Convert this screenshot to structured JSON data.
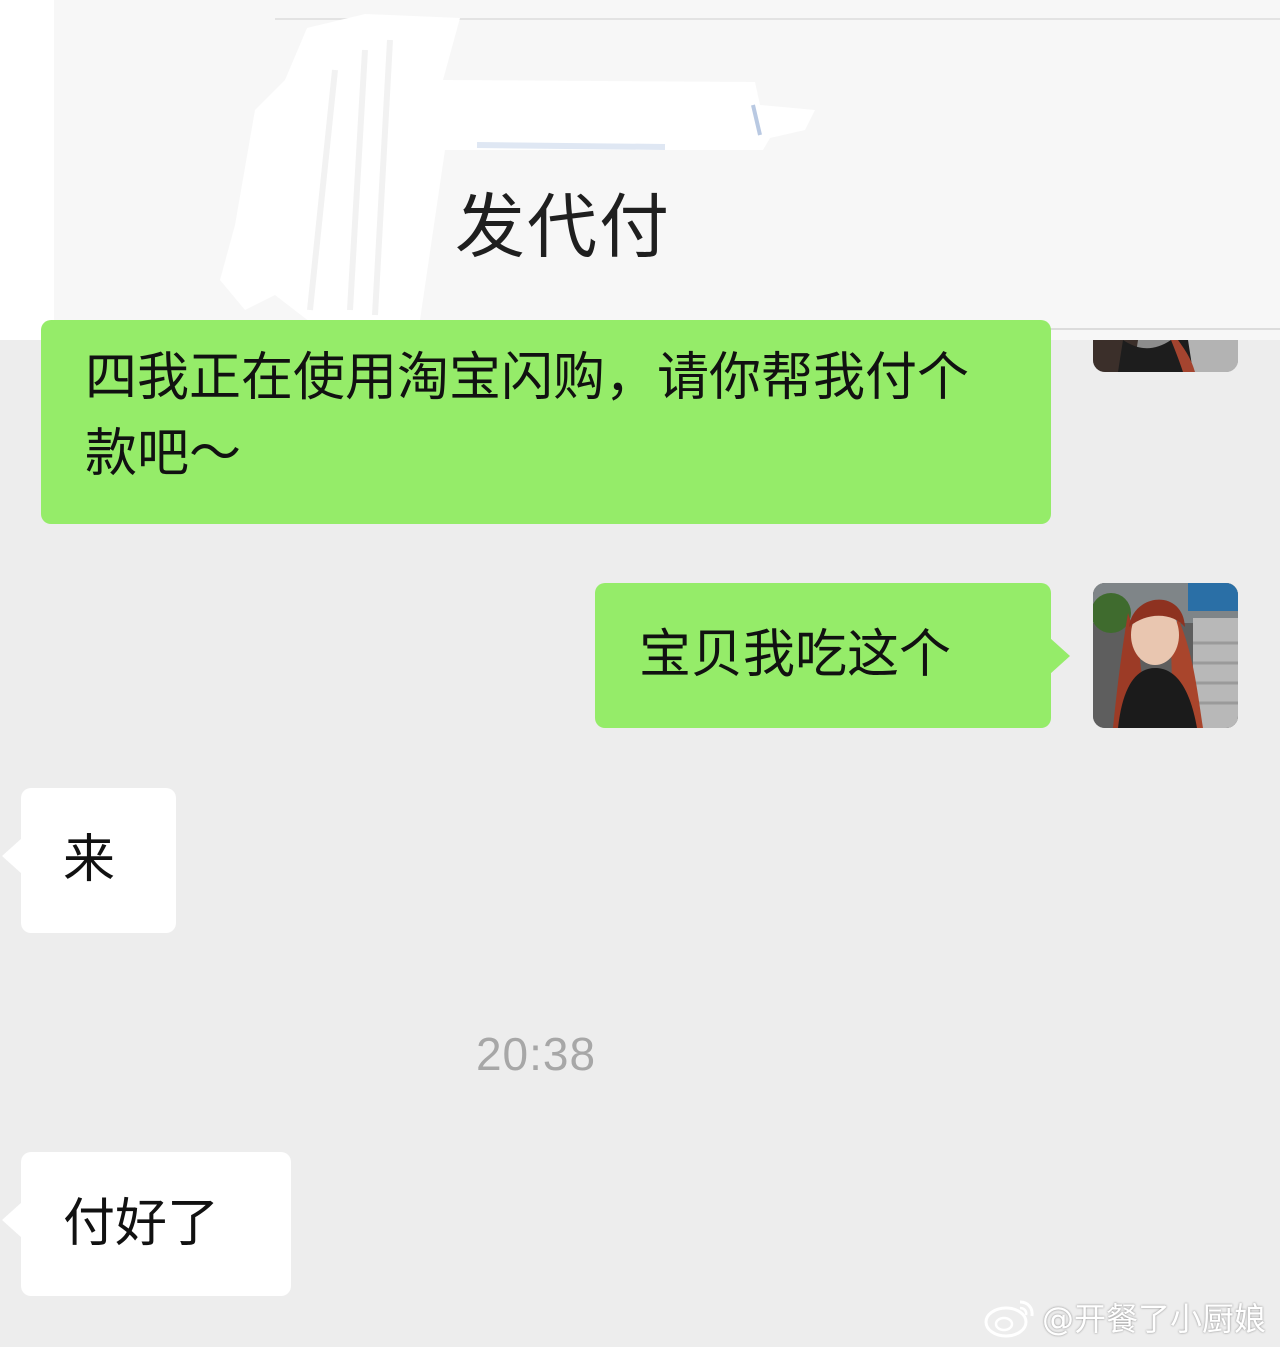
{
  "header_card": {
    "subtitle": "发代付"
  },
  "messages": [
    {
      "side": "sent",
      "text": "四我正在使用淘宝闪购，请你帮我付个款吧～"
    },
    {
      "side": "sent",
      "text": "宝贝我吃这个"
    },
    {
      "side": "received",
      "text": "来"
    },
    {
      "side": "received",
      "text": "付好了"
    }
  ],
  "timestamp": "20:38",
  "watermark": {
    "text": "@开餐了小厨娘",
    "icon": "weibo-logo-icon"
  },
  "colors": {
    "chat_background": "#ededed",
    "sent_bubble": "#95ec69",
    "received_bubble": "#ffffff",
    "timestamp_text": "#a7a7a7"
  }
}
